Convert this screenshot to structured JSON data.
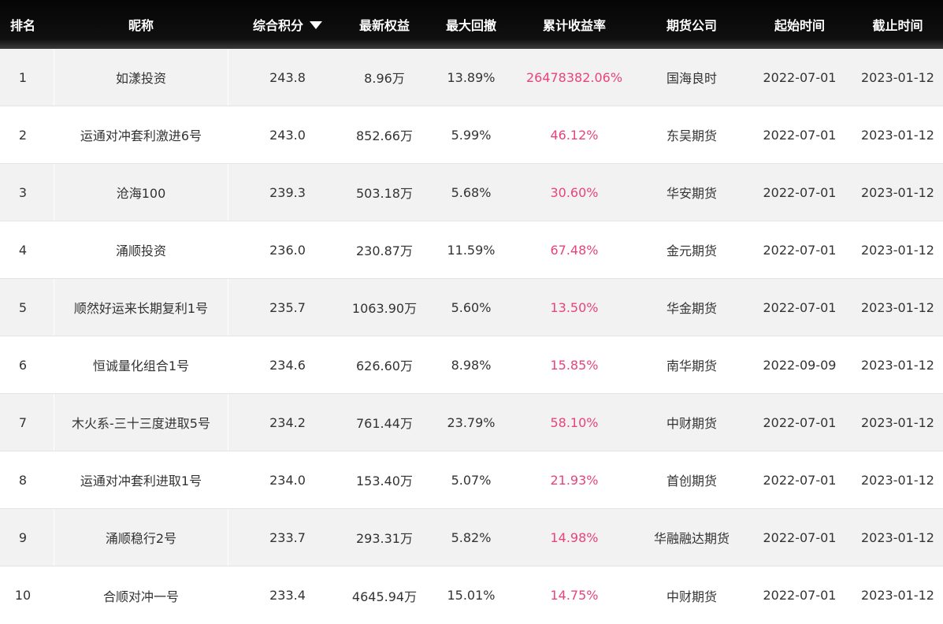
{
  "headers": {
    "rank": "排名",
    "nickname": "昵称",
    "score": "综合积分",
    "equity": "最新权益",
    "drawdown": "最大回撤",
    "return_rate": "累计收益率",
    "company": "期货公司",
    "start": "起始时间",
    "end": "截止时间"
  },
  "colors": {
    "header_bg": "#0a0a0a",
    "rate_text": "#e8447a",
    "row_alt": "#f2f2f2"
  },
  "rows": [
    {
      "rank": "1",
      "nickname": "如漾投资",
      "score": "243.8",
      "equity": "8.96万",
      "drawdown": "13.89%",
      "return_rate": "26478382.06%",
      "company": "国海良时",
      "start": "2022-07-01",
      "end": "2023-01-12"
    },
    {
      "rank": "2",
      "nickname": "运通对冲套利激进6号",
      "score": "243.0",
      "equity": "852.66万",
      "drawdown": "5.99%",
      "return_rate": "46.12%",
      "company": "东吴期货",
      "start": "2022-07-01",
      "end": "2023-01-12"
    },
    {
      "rank": "3",
      "nickname": "沧海100",
      "score": "239.3",
      "equity": "503.18万",
      "drawdown": "5.68%",
      "return_rate": "30.60%",
      "company": "华安期货",
      "start": "2022-07-01",
      "end": "2023-01-12"
    },
    {
      "rank": "4",
      "nickname": "涌顺投资",
      "score": "236.0",
      "equity": "230.87万",
      "drawdown": "11.59%",
      "return_rate": "67.48%",
      "company": "金元期货",
      "start": "2022-07-01",
      "end": "2023-01-12"
    },
    {
      "rank": "5",
      "nickname": "顺然好运来长期复利1号",
      "score": "235.7",
      "equity": "1063.90万",
      "drawdown": "5.60%",
      "return_rate": "13.50%",
      "company": "华金期货",
      "start": "2022-07-01",
      "end": "2023-01-12"
    },
    {
      "rank": "6",
      "nickname": "恒诚量化组合1号",
      "score": "234.6",
      "equity": "626.60万",
      "drawdown": "8.98%",
      "return_rate": "15.85%",
      "company": "南华期货",
      "start": "2022-09-09",
      "end": "2023-01-12"
    },
    {
      "rank": "7",
      "nickname": "木火系-三十三度进取5号",
      "score": "234.2",
      "equity": "761.44万",
      "drawdown": "23.79%",
      "return_rate": "58.10%",
      "company": "中财期货",
      "start": "2022-07-01",
      "end": "2023-01-12"
    },
    {
      "rank": "8",
      "nickname": "运通对冲套利进取1号",
      "score": "234.0",
      "equity": "153.40万",
      "drawdown": "5.07%",
      "return_rate": "21.93%",
      "company": "首创期货",
      "start": "2022-07-01",
      "end": "2023-01-12"
    },
    {
      "rank": "9",
      "nickname": "涌顺稳行2号",
      "score": "233.7",
      "equity": "293.31万",
      "drawdown": "5.82%",
      "return_rate": "14.98%",
      "company": "华融融达期货",
      "start": "2022-07-01",
      "end": "2023-01-12"
    },
    {
      "rank": "10",
      "nickname": "合顺对冲一号",
      "score": "233.4",
      "equity": "4645.94万",
      "drawdown": "15.01%",
      "return_rate": "14.75%",
      "company": "中财期货",
      "start": "2022-07-01",
      "end": "2023-01-12"
    }
  ]
}
